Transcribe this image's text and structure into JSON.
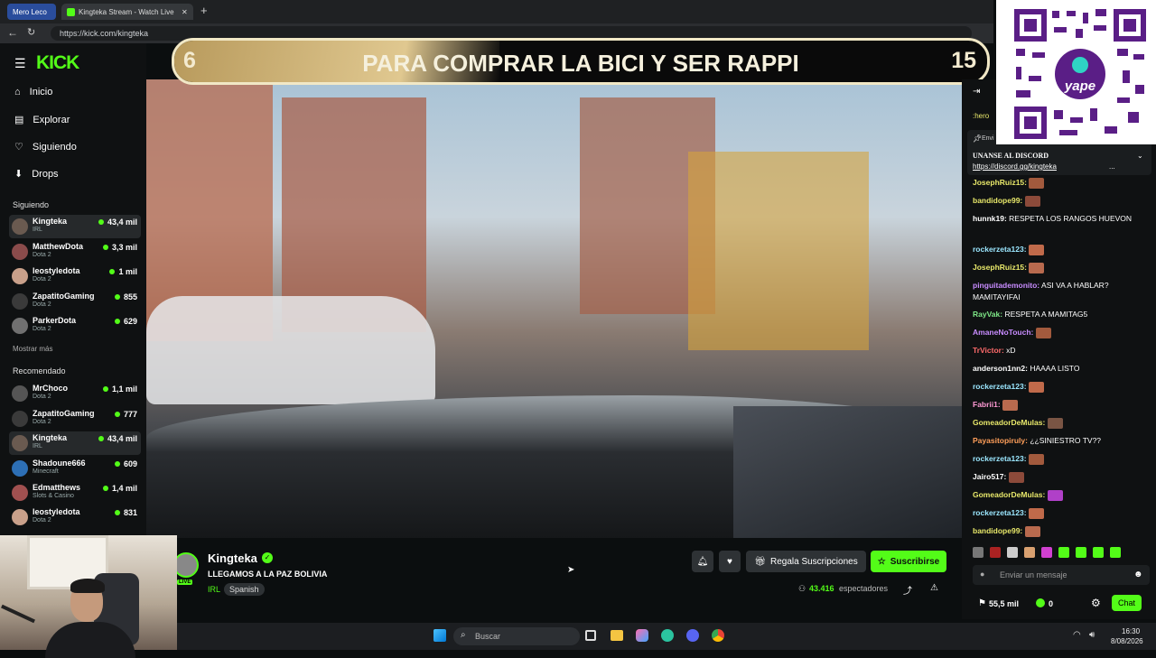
{
  "browser": {
    "tab1_label": "Mero Leco",
    "tab2_label": "Kingteka Stream - Watch Live",
    "url": "https://kick.com/kingteka"
  },
  "sidebar": {
    "logo": "KICK",
    "nav": [
      {
        "label": "Inicio",
        "icon": "home-icon"
      },
      {
        "label": "Explorar",
        "icon": "browse-icon"
      },
      {
        "label": "Siguiendo",
        "icon": "heart-icon"
      },
      {
        "label": "Drops",
        "icon": "drops-icon"
      }
    ],
    "following_title": "Siguiendo",
    "following": [
      {
        "name": "Kingteka",
        "category": "IRL",
        "viewers": "43,4 mil"
      },
      {
        "name": "MatthewDota",
        "category": "Dota 2",
        "viewers": "3,3 mil"
      },
      {
        "name": "leostyledota",
        "category": "Dota 2",
        "viewers": "1 mil"
      },
      {
        "name": "ZapatitoGaming",
        "category": "Dota 2",
        "viewers": "855"
      },
      {
        "name": "ParkerDota",
        "category": "Dota 2",
        "viewers": "629"
      }
    ],
    "show_more": "Mostrar más",
    "recommended_title": "Recomendado",
    "recommended": [
      {
        "name": "MrChoco",
        "category": "Dota 2",
        "viewers": "1,1 mil"
      },
      {
        "name": "ZapatitoGaming",
        "category": "Dota 2",
        "viewers": "777"
      },
      {
        "name": "Kingteka",
        "category": "IRL",
        "viewers": "43,4 mil"
      },
      {
        "name": "Shadoune666",
        "category": "Minecraft",
        "viewers": "609"
      },
      {
        "name": "Edmatthews",
        "category": "Slots & Casino",
        "viewers": "1,4 mil"
      },
      {
        "name": "leostyledota",
        "category": "Dota 2",
        "viewers": "831"
      }
    ]
  },
  "banner": {
    "left_number": "6",
    "text": "PARA COMPRAR LA BICI Y SER RAPPI",
    "right_number": "15"
  },
  "stream": {
    "channel": "Kingteka",
    "title": "LLEGAMOS A LA PAZ BOLIVIA",
    "category": "IRL",
    "language": "Spanish",
    "live_label": "LIVE",
    "viewers": "43.416",
    "viewers_label": "espectadores",
    "gift_label": "Regala Suscripciones",
    "subscribe_label": "Suscribirse"
  },
  "chat": {
    "pinned_header": ":hero",
    "pinned_by": "Envi",
    "pinned_title": "UNANSE AL DISCORD",
    "pinned_link": "https://discord.gg/kingteka",
    "pinned_more": "...",
    "messages": [
      {
        "user": "JosephRuiz15:",
        "text": "",
        "color": "#e8e86a"
      },
      {
        "user": "bandidope99:",
        "text": "",
        "color": "#e8e86a"
      },
      {
        "user": "hunnk19:",
        "text": "RESPETA LOS RANGOS HUEVON",
        "color": "#ffffff"
      },
      {
        "user": "rockerzeta123:",
        "text": "",
        "color": "#9be7ff"
      },
      {
        "user": "JosephRuiz15:",
        "text": "",
        "color": "#e8e86a"
      },
      {
        "user": "pinguitademonito:",
        "text": "ASI VA A HABLAR? MAMITAYIFAI",
        "color": "#c88cff"
      },
      {
        "user": "RayVak:",
        "text": "RESPETA A MAMITAG5",
        "color": "#7ee787"
      },
      {
        "user": "AmaneNoTouch:",
        "text": "",
        "color": "#c88cff"
      },
      {
        "user": "TrVictor:",
        "text": "xD",
        "color": "#ff6b6b"
      },
      {
        "user": "anderson1nn2:",
        "text": "HAAAA LISTO",
        "color": "#ffffff"
      },
      {
        "user": "rockerzeta123:",
        "text": "",
        "color": "#9be7ff"
      },
      {
        "user": "Fabrii1:",
        "text": "",
        "color": "#ff9ad5"
      },
      {
        "user": "GomeadorDeMulas:",
        "text": "",
        "color": "#e8e86a"
      },
      {
        "user": "Payasitopiruly:",
        "text": "¿¿SINIESTRO TV??",
        "color": "#ff9f5a"
      },
      {
        "user": "rockerzeta123:",
        "text": "",
        "color": "#9be7ff"
      },
      {
        "user": "Jairo517:",
        "text": "",
        "color": "#ffffff"
      },
      {
        "user": "GomeadorDeMulas:",
        "text": "",
        "color": "#e8e86a"
      },
      {
        "user": "rockerzeta123:",
        "text": "",
        "color": "#9be7ff"
      },
      {
        "user": "bandidope99:",
        "text": "",
        "color": "#e8e86a"
      }
    ],
    "input_placeholder": "Enviar un mensaje",
    "points": "55,5 mil",
    "kick_points": "0",
    "chat_button": "Chat"
  },
  "qr": {
    "brand": "yape"
  },
  "taskbar": {
    "search_placeholder": "Buscar",
    "time": "16:30",
    "date": "8/08/2026"
  },
  "colors": {
    "accent": "#53fc18",
    "background": "#0b0e0f",
    "banner_gold": "#c9a866"
  }
}
